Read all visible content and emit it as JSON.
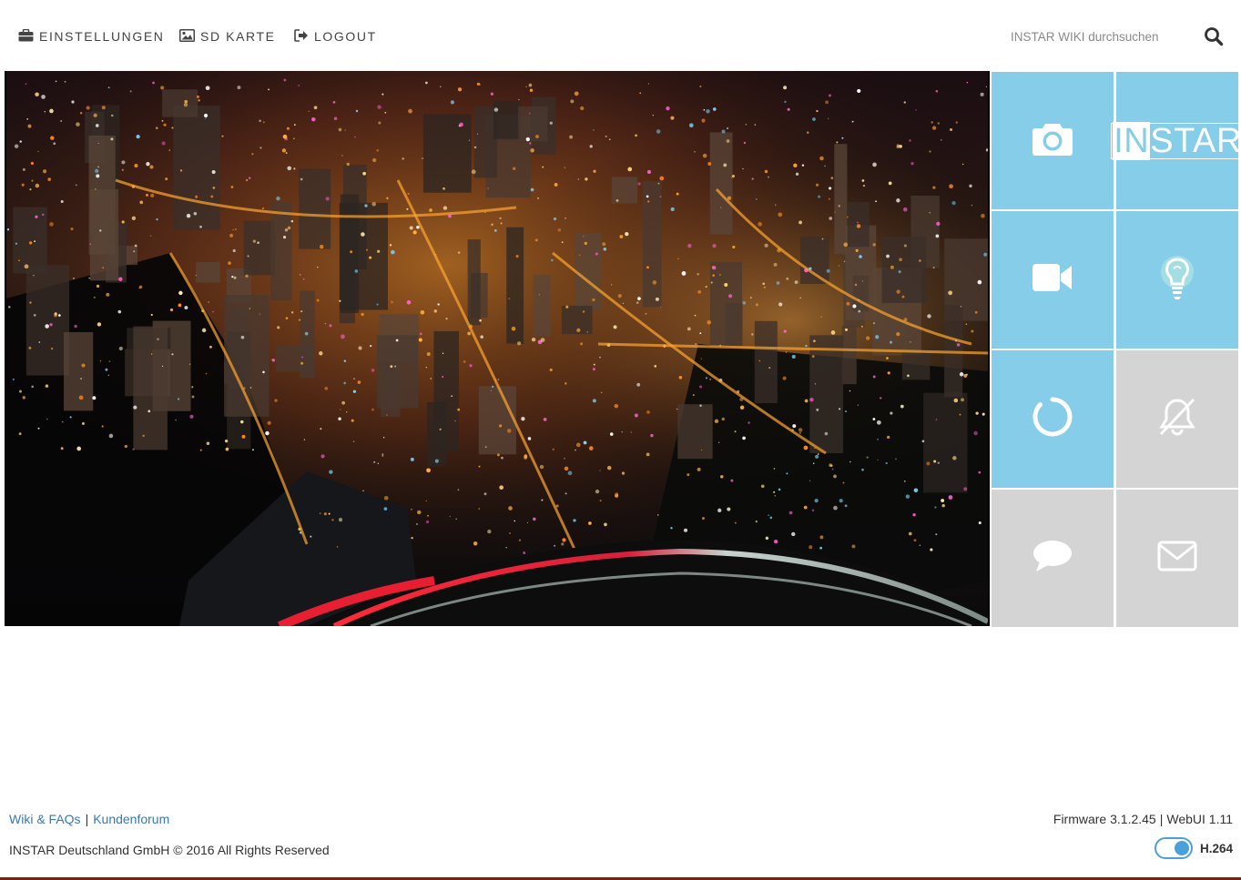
{
  "nav": {
    "settings_label": "EINSTELLUNGEN",
    "sd_card_label": "SD KARTE",
    "logout_label": "LOGOUT"
  },
  "search": {
    "placeholder": "INSTAR WIKI durchsuchen"
  },
  "tiles": [
    {
      "name": "snapshot",
      "icon": "camera-icon",
      "color": "blue"
    },
    {
      "name": "instar-logo",
      "icon": "instar-logo",
      "color": "blue"
    },
    {
      "name": "record-video",
      "icon": "video-camera-icon",
      "color": "blue"
    },
    {
      "name": "ir-led",
      "icon": "lightbulb-icon",
      "color": "blue"
    },
    {
      "name": "reload",
      "icon": "circle-spinner-icon",
      "color": "blue"
    },
    {
      "name": "alarm-off",
      "icon": "bell-slash-icon",
      "color": "gray"
    },
    {
      "name": "chat",
      "icon": "speech-bubble-icon",
      "color": "gray"
    },
    {
      "name": "email",
      "icon": "envelope-icon",
      "color": "gray"
    }
  ],
  "logo": {
    "text_highlight": "IN",
    "text_rest": "STAR"
  },
  "footer": {
    "wiki_link": "Wiki & FAQs",
    "separator": "|",
    "forum_link": "Kundenforum",
    "copyright": "INSTAR Deutschland GmbH © 2016 All Rights Reserved",
    "firmware": "Firmware 3.1.2.45",
    "webui": "WebUI 1.11",
    "codec_label": "H.264"
  },
  "colors": {
    "tile_blue": "#86cde9",
    "tile_gray": "#d4d4d4",
    "link": "#3b76b8",
    "toggle": "#4aa0d8"
  }
}
